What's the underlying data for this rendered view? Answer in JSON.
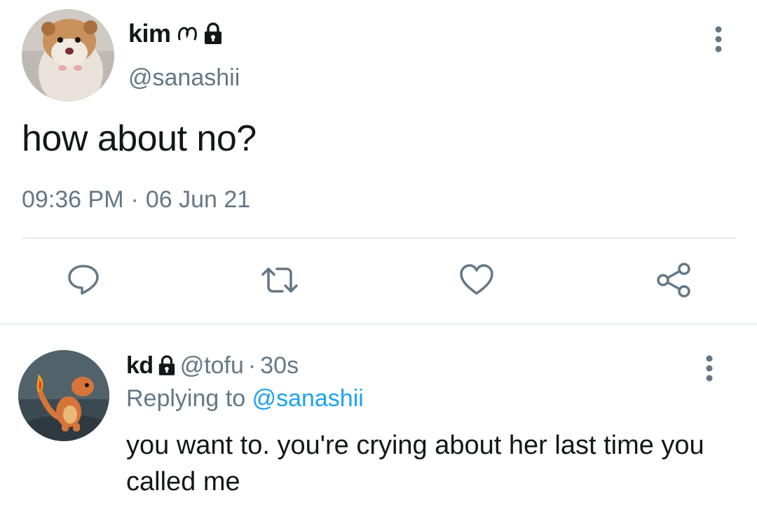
{
  "main_tweet": {
    "display_name": "kim",
    "name_symbol": "ᡕ",
    "handle": "@sanashii",
    "text": "how about no?",
    "time": "09:36 PM",
    "separator": "·",
    "date": "06 Jun 21",
    "icons": {
      "avatar": "hamster-avatar",
      "verified": "lock-icon",
      "more": "more-vertical-icon",
      "reply": "reply-icon",
      "retweet": "retweet-icon",
      "like": "heart-icon",
      "share": "share-icon"
    }
  },
  "reply_tweet": {
    "display_name": "kd",
    "handle": "@tofu",
    "separator": "·",
    "time": "30s",
    "replying_label": "Replying to",
    "replying_handle": "@sanashii",
    "text": "you want to. you're crying about her last time you called me",
    "icons": {
      "avatar": "charmander-avatar",
      "lock": "lock-icon",
      "more": "more-vertical-icon"
    }
  },
  "colors": {
    "text_primary": "#14171a",
    "text_secondary": "#657786",
    "link": "#1da1f2",
    "divider": "#e6ecf0",
    "icon": "#657786"
  }
}
